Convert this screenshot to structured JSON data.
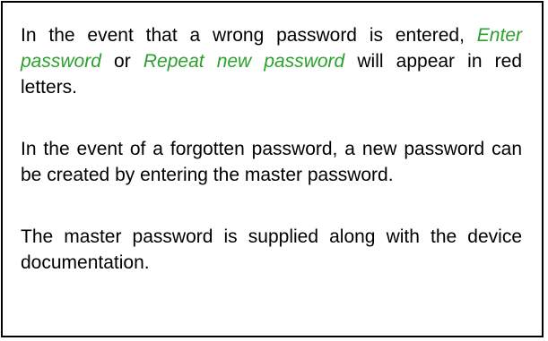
{
  "note": {
    "p1": {
      "a": "In the event that a wrong password is entered,",
      "term1": "Enter password",
      "b": "or",
      "term2": "Repeat new password",
      "c": "will appear in red letters."
    },
    "p2": "In the event of a forgotten password, a new password can be created by entering the master password.",
    "p3": "The master password is supplied along with the device documentation."
  },
  "colors": {
    "highlight_text": "#2ca02c",
    "body_text": "#000000",
    "border": "#000000"
  }
}
